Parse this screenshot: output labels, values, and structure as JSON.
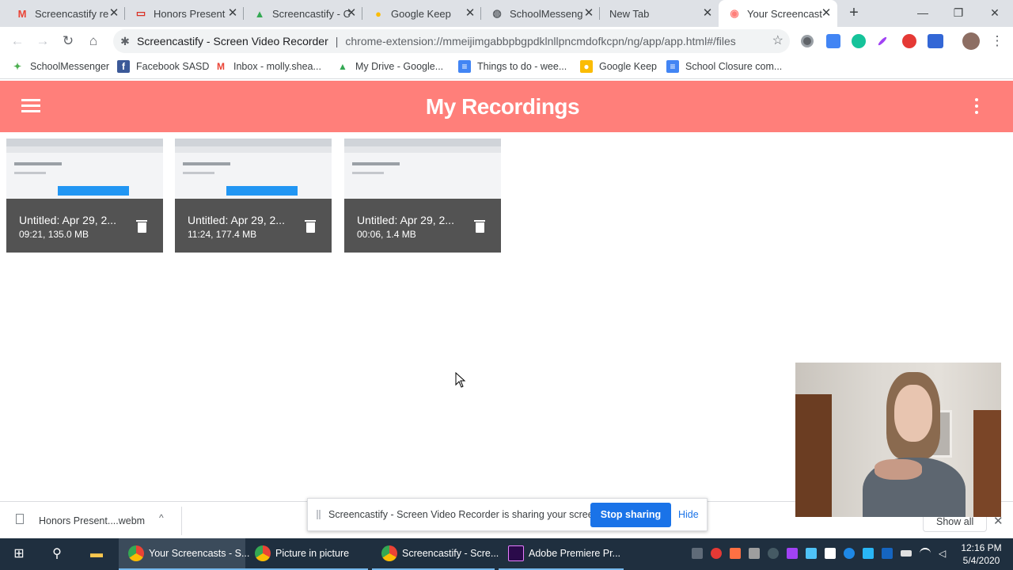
{
  "browser": {
    "tabs": [
      {
        "label": "Screencastify re",
        "icon": "gmail-icon",
        "icon_glyph": "M",
        "icon_color": "#ea4335"
      },
      {
        "label": "Honors Present",
        "icon": "slides-icon",
        "icon_glyph": "▭",
        "icon_color": "#d93025"
      },
      {
        "label": "Screencastify - C",
        "icon": "drive-icon",
        "icon_glyph": "▲",
        "icon_color": "#34a853"
      },
      {
        "label": "Google Keep",
        "icon": "keep-icon",
        "icon_glyph": "●",
        "icon_color": "#fbbc04"
      },
      {
        "label": "SchoolMesseng",
        "icon": "globe-icon",
        "icon_glyph": "◍",
        "icon_color": "#5f6368"
      },
      {
        "label": "New Tab",
        "icon": "none",
        "icon_glyph": "",
        "icon_color": "#5f6368"
      },
      {
        "label": "Your Screencast",
        "icon": "screencastify-icon",
        "icon_glyph": "◉",
        "icon_color": "#ff7f7a"
      }
    ],
    "tab_close": "✕",
    "new_tab": "+",
    "window_controls": {
      "minimize": "—",
      "restore": "❐",
      "close": "✕"
    },
    "nav": {
      "back": "←",
      "forward": "→",
      "reload": "↻",
      "home": "⌂"
    },
    "omnibox": {
      "site": "Screencastify - Screen Video Recorder",
      "separator": "|",
      "url": "chrome-extension://mmeijimgabbpbgpdklnllpncmdofkcpn/ng/app/app.html#/files",
      "ext_icon": "puzzle-icon",
      "star": "☆"
    },
    "bookmarks": [
      {
        "label": "SchoolMessenger",
        "icon": "schoolmessenger-icon",
        "glyph": "✦",
        "color": "#4caf50"
      },
      {
        "label": "Facebook SASD",
        "icon": "facebook-icon",
        "glyph": "f",
        "color": "#3b5998"
      },
      {
        "label": "Inbox - molly.shea...",
        "icon": "gmail-icon",
        "glyph": "M",
        "color": "#ea4335"
      },
      {
        "label": "My Drive - Google...",
        "icon": "drive-icon",
        "glyph": "▲",
        "color": "#34a853"
      },
      {
        "label": "Things to do - wee...",
        "icon": "docs-icon",
        "glyph": "≡",
        "color": "#4285f4"
      },
      {
        "label": "Google Keep",
        "icon": "keep-icon",
        "glyph": "●",
        "color": "#fbbc04"
      },
      {
        "label": "School Closure com...",
        "icon": "docs-icon",
        "glyph": "≡",
        "color": "#4285f4"
      }
    ]
  },
  "app": {
    "title": "My Recordings",
    "accent": "#ff7f7a",
    "recordings": [
      {
        "title": "Untitled: Apr 29, 2...",
        "meta": "09:21, 135.0 MB"
      },
      {
        "title": "Untitled: Apr 29, 2...",
        "meta": "11:24, 177.4 MB"
      },
      {
        "title": "Untitled: Apr 29, 2...",
        "meta": "00:06, 1.4 MB"
      }
    ]
  },
  "download_bar": {
    "file": "Honors Present....webm",
    "chevron": "^",
    "show_all": "Show all",
    "close": "✕"
  },
  "share_bar": {
    "message": "Screencastify - Screen Video Recorder is sharing your screen.",
    "stop_label": "Stop sharing",
    "hide_label": "Hide"
  },
  "taskbar": {
    "apps": [
      {
        "label": "Your Screencasts - S...",
        "icon": "chrome-icon",
        "color": "#fbbc04",
        "active": true
      },
      {
        "label": "Picture in picture",
        "icon": "chrome-icon",
        "color": "#fbbc04",
        "active": false
      },
      {
        "label": "Screencastify - Scre...",
        "icon": "chrome-icon",
        "color": "#fbbc04",
        "active": false
      },
      {
        "label": "Adobe Premiere Pr...",
        "icon": "premiere-icon",
        "color": "#2a0a4a",
        "active": false
      }
    ],
    "time": "12:16 PM",
    "date": "5/4/2020"
  }
}
